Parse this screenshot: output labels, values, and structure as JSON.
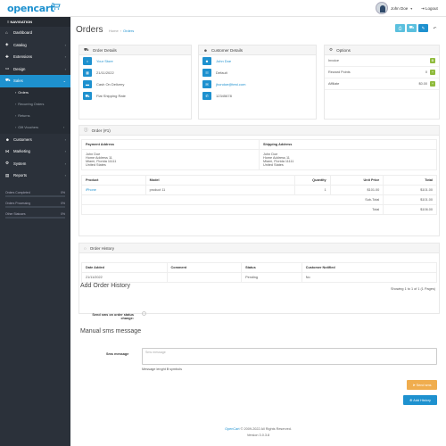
{
  "header": {
    "logo": "opencart",
    "user_name": "John Doe",
    "logout": "Logout"
  },
  "sidebar": {
    "title": "NAVIGATION",
    "items": [
      {
        "label": "Dashboard",
        "icon": "dashboard-icon",
        "glyph": "⌂",
        "chevron": false
      },
      {
        "label": "Catalog",
        "icon": "tag-icon",
        "glyph": "◈",
        "chevron": true
      },
      {
        "label": "Extensions",
        "icon": "puzzle-icon",
        "glyph": "✚",
        "chevron": true
      },
      {
        "label": "Design",
        "icon": "monitor-icon",
        "glyph": "▭",
        "chevron": true
      },
      {
        "label": "Sales",
        "icon": "cart-icon",
        "glyph": "⛟",
        "chevron": true,
        "active": true
      }
    ],
    "sales_sub": [
      "Orders",
      "Recurring Orders",
      "Returns",
      "Gift Vouchers"
    ],
    "items_after": [
      {
        "label": "Customers",
        "icon": "user-icon",
        "glyph": "☻",
        "chevron": true
      },
      {
        "label": "Marketing",
        "icon": "share-icon",
        "glyph": "⋈",
        "chevron": true
      },
      {
        "label": "System",
        "icon": "gear-icon",
        "glyph": "⚙",
        "chevron": true
      },
      {
        "label": "Reports",
        "icon": "bar-chart-icon",
        "glyph": "▤",
        "chevron": true
      }
    ],
    "stats": [
      {
        "label": "Orders Completed",
        "value": "0%"
      },
      {
        "label": "Orders Processing",
        "value": "0%"
      },
      {
        "label": "Other Statuses",
        "value": "0%"
      }
    ]
  },
  "page": {
    "title": "Orders",
    "breadcrumb_home": "Home",
    "breadcrumb_current": "Orders"
  },
  "order_details": {
    "title": "Order Details",
    "store": "Your Store",
    "date": "21/11/2022",
    "payment": "Cash On Delivery",
    "shipping": "Flat Shipping Rate"
  },
  "customer_details": {
    "title": "Customer Details",
    "name": "John Doe",
    "group": "Default",
    "email": "jhondoe@test.com",
    "phone": "12345678"
  },
  "options": {
    "title": "Options",
    "rows": [
      {
        "label": "Invoice",
        "value": ""
      },
      {
        "label": "Reward Points",
        "value": "0"
      },
      {
        "label": "Affiliate",
        "value": "$0.00"
      }
    ]
  },
  "order": {
    "title": "Order (#1)",
    "payment_address_label": "Payment Address",
    "shipping_address_label": "Shipping Address",
    "payment_address": [
      "John Doe",
      "Home Address 11",
      "Miami, Florida 11111",
      "United States"
    ],
    "shipping_address": [
      "John Doe",
      "Home Address 11",
      "Miami, Florida 11111",
      "United States"
    ],
    "columns": [
      "Product",
      "Model",
      "Quantity",
      "Unit Price",
      "Total"
    ],
    "products": [
      {
        "product": "iPhone",
        "model": "product 11",
        "quantity": "1",
        "unit_price": "$101.00",
        "total": "$101.00"
      }
    ],
    "totals": [
      {
        "label": "Sub-Total",
        "value": "$101.00"
      },
      {
        "label": "Total",
        "value": "$106.00"
      }
    ]
  },
  "history": {
    "title": "Order History",
    "columns": [
      "Date Added",
      "Comment",
      "Status",
      "Customer Notified"
    ],
    "rows": [
      {
        "date": "21/11/2022",
        "comment": "",
        "status": "Pending",
        "notified": "No"
      }
    ],
    "pagination": "Showing 1 to 1 of 1 (1 Pages)"
  },
  "add_history": {
    "title": "Add Order History",
    "send_sms_label": "Send sms on order status change:",
    "manual_title": "Manual sms message",
    "sms_label": "Sms message",
    "sms_placeholder": "Sms message",
    "length_text": "Message lenght",
    "length_value": "0",
    "length_suffix": "symbols",
    "send_button": "Send sms",
    "add_button": "Add History"
  },
  "footer": {
    "brand": "OpenCart",
    "copyright": " © 2009-2022 All Rights Reserved.",
    "version": "Version 3.0.3.8"
  },
  "colors": {
    "accent": "#1e91cf",
    "sidebar": "#2b313a",
    "success": "#8fbb3c",
    "warning": "#f0ad4e"
  }
}
